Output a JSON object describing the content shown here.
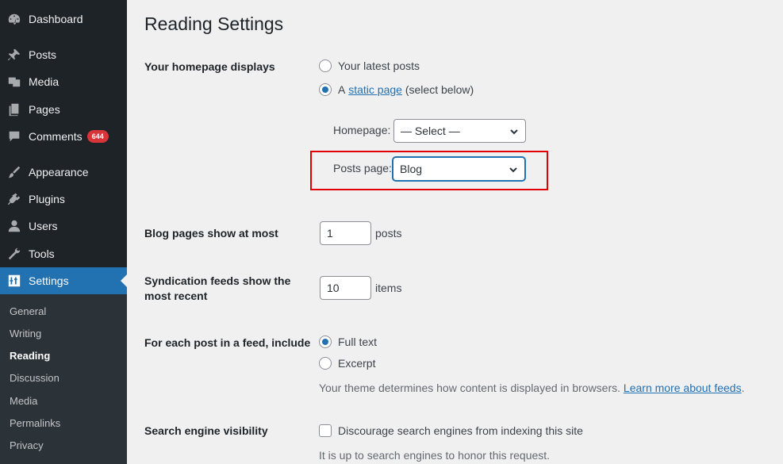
{
  "sidebar": {
    "items": [
      {
        "label": "Dashboard",
        "icon": "dashboard-icon"
      },
      {
        "label": "Posts",
        "icon": "pin-icon"
      },
      {
        "label": "Media",
        "icon": "media-icon"
      },
      {
        "label": "Pages",
        "icon": "pages-icon"
      },
      {
        "label": "Comments",
        "icon": "comment-icon",
        "badge": "644"
      },
      {
        "label": "Appearance",
        "icon": "brush-icon"
      },
      {
        "label": "Plugins",
        "icon": "plugin-icon"
      },
      {
        "label": "Users",
        "icon": "user-icon"
      },
      {
        "label": "Tools",
        "icon": "wrench-icon"
      },
      {
        "label": "Settings",
        "icon": "settings-icon",
        "active": true
      }
    ],
    "submenu": [
      "General",
      "Writing",
      "Reading",
      "Discussion",
      "Media",
      "Permalinks",
      "Privacy"
    ],
    "current_submenu": "Reading"
  },
  "page": {
    "title": "Reading Settings",
    "homepage_displays": {
      "label": "Your homepage displays",
      "option_latest": "Your latest posts",
      "option_static_prefix": "A",
      "option_static_link": "static page",
      "option_static_suffix": "(select below)",
      "selected": "static"
    },
    "homepage_select": {
      "label": "Homepage:",
      "value": "— Select —"
    },
    "posts_page_select": {
      "label": "Posts page:",
      "value": "Blog"
    },
    "blog_pages": {
      "label": "Blog pages show at most",
      "value": "1",
      "unit": "posts"
    },
    "syndication": {
      "label_line1": "Syndication feeds show the",
      "label_line2": "most recent",
      "value": "10",
      "unit": "items"
    },
    "feed_include": {
      "label": "For each post in a feed, include",
      "option_full": "Full text",
      "option_excerpt": "Excerpt",
      "selected": "full",
      "desc_text": "Your theme determines how content is displayed in browsers.",
      "desc_link": "Learn more about feeds"
    },
    "search_visibility": {
      "label": "Search engine visibility",
      "checkbox_label": "Discourage search engines from indexing this site",
      "checked": false,
      "desc": "It is up to search engines to honor this request."
    }
  },
  "colors": {
    "sidebar_bg": "#1d2327",
    "accent": "#2271b1",
    "highlight": "#e00000",
    "badge": "#d63638"
  }
}
